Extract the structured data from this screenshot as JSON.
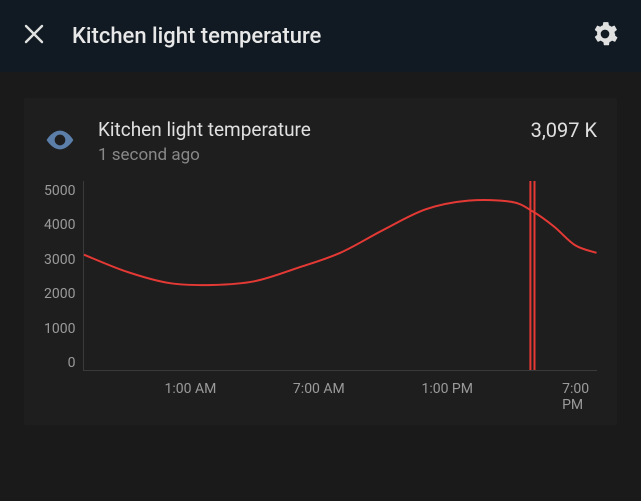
{
  "header": {
    "title": "Kitchen light temperature"
  },
  "card": {
    "title": "Kitchen light temperature",
    "subtitle": "1 second ago",
    "value": "3,097 K"
  },
  "colors": {
    "line": "#e53935",
    "accent_eye": "#5b7fa8"
  },
  "chart_data": {
    "type": "line",
    "title": "Kitchen light temperature",
    "xlabel": "",
    "ylabel": "",
    "ylim": [
      0,
      5000
    ],
    "y_ticks": [
      5000,
      4000,
      3000,
      2000,
      1000,
      0
    ],
    "x_ticks": [
      "1:00 AM",
      "7:00 AM",
      "1:00 PM",
      "7:00 PM"
    ],
    "x_tick_hours": [
      1,
      7,
      13,
      19
    ],
    "x_range_hours": [
      -4,
      20
    ],
    "series": [
      {
        "name": "Kitchen light temperature",
        "x_hours": [
          -4,
          -2,
          0,
          2,
          4,
          6,
          8,
          10,
          12,
          14,
          16,
          17,
          18,
          19,
          20
        ],
        "values": [
          3050,
          2600,
          2300,
          2250,
          2350,
          2700,
          3100,
          3700,
          4250,
          4480,
          4450,
          4200,
          3800,
          3300,
          3100
        ]
      }
    ],
    "marker_x_hour": 17,
    "current_value": 3097
  }
}
